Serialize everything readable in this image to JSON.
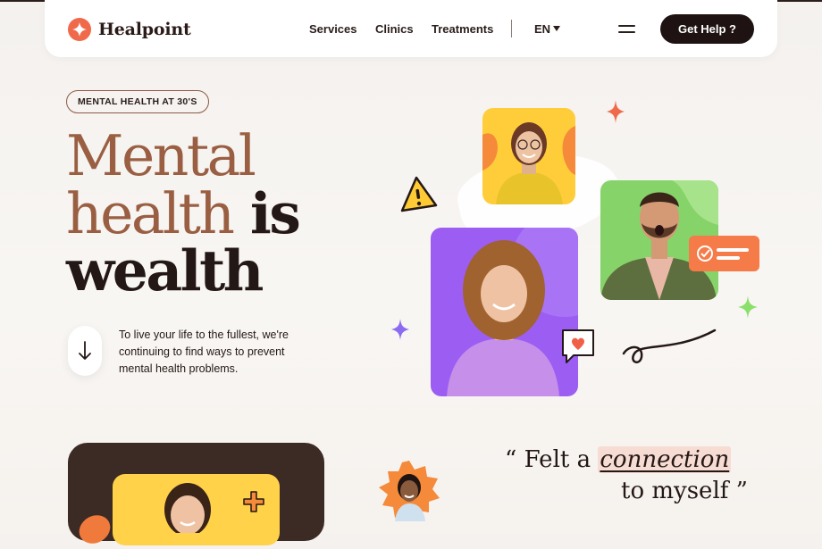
{
  "nav": {
    "brand": "Healpoint",
    "links": [
      "Services",
      "Clinics",
      "Treatments"
    ],
    "language": "EN",
    "cta": "Get Help ?"
  },
  "hero": {
    "tag": "MENTAL HEALTH AT 30'S",
    "headline_line1": "Mental",
    "headline_line2a": "health",
    "headline_line2b": "is",
    "headline_line3": "wealth",
    "lead": "To live your life to the fullest, we're continuing to find ways to prevent mental health problems."
  },
  "testimonial": {
    "open_quote": "“",
    "part1": "Felt a",
    "highlight": "connection",
    "part2": "to myself",
    "close_quote": "”"
  },
  "colors": {
    "accent_orange": "#f0694a",
    "brown": "#9a5f42",
    "dark": "#1e1312",
    "yellow": "#ffcd3a",
    "green": "#86d36a",
    "purple": "#9c5ef2"
  },
  "icons": [
    "logo-star-icon",
    "chevron-down-icon",
    "menu-icon",
    "arrow-down-icon",
    "warning-icon",
    "sparkle-icon",
    "heart-icon",
    "check-icon",
    "plus-icon"
  ]
}
